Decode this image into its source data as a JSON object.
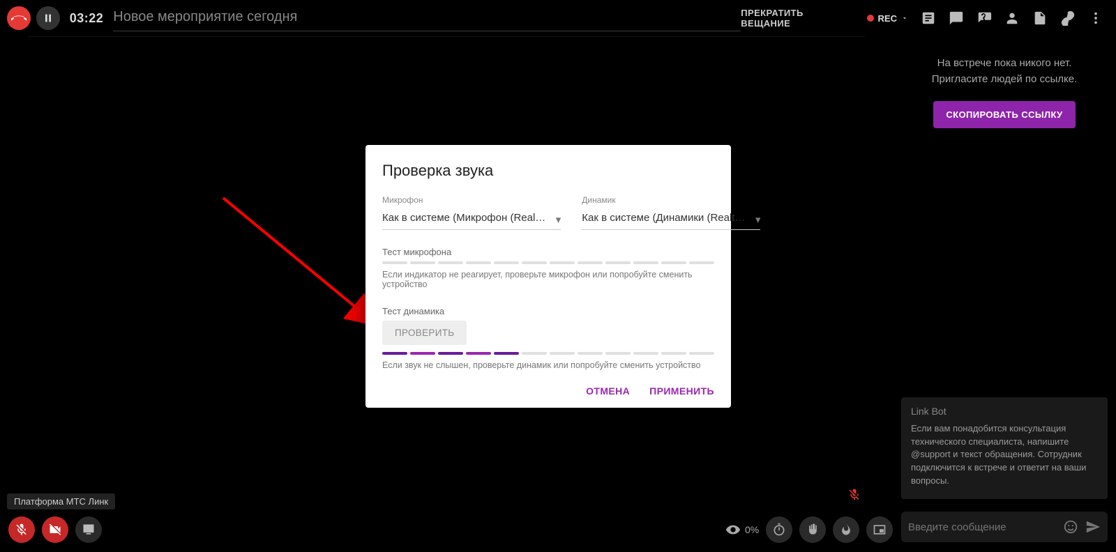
{
  "topbar": {
    "timer": "03:22",
    "title": "Новое мероприятие сегодня",
    "stop_broadcast": "ПРЕКРАТИТЬ ВЕЩАНИЕ",
    "rec": "REC"
  },
  "sidebar": {
    "empty_line1": "На встрече пока никого нет.",
    "empty_line2": "Пригласите людей по ссылке.",
    "copy_link": "СКОПИРОВАТЬ ССЫЛКУ",
    "bot_title": "Link Bot",
    "bot_text": "Если вам понадобится консультация технического специалиста, напишите @support и текст обращения. Сотрудник подключится к встрече и ответит на ваши вопросы.",
    "chat_placeholder": "Введите сообщение"
  },
  "bottom": {
    "visibility_pct": "0%"
  },
  "platform_tag": "Платформа МТС Линк",
  "modal": {
    "title": "Проверка звука",
    "mic_label": "Микрофон",
    "mic_value": "Как в системе (Микрофон (Real…",
    "spk_label": "Динамик",
    "spk_value": "Как в системе (Динамики (Realt…",
    "mic_test_label": "Тест микрофона",
    "mic_hint": "Если индикатор не реагирует, проверьте микрофон или попробуйте сменить устройство",
    "spk_test_label": "Тест динамика",
    "test_button": "ПРОВЕРИТЬ",
    "spk_hint": "Если звук не слышен, проверьте динамик или попробуйте сменить устройство",
    "cancel": "ОТМЕНА",
    "apply": "ПРИМЕНИТЬ",
    "mic_meter_on": 0,
    "spk_meter_on": 5
  }
}
